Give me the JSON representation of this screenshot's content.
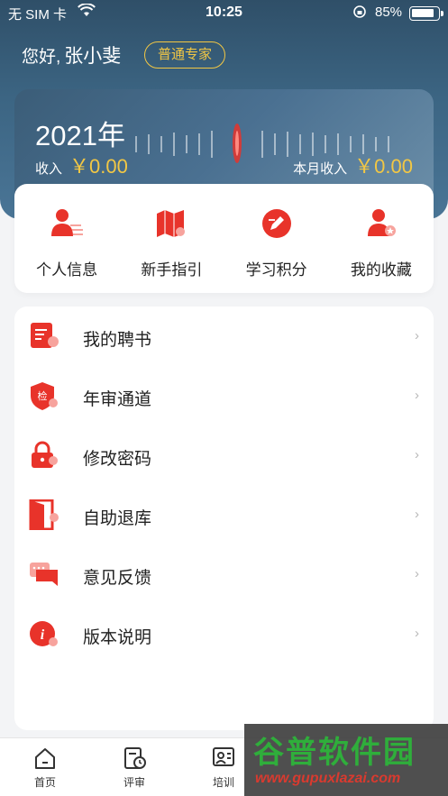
{
  "status_bar": {
    "carrier": "无 SIM 卡",
    "time": "10:25",
    "battery": "85%"
  },
  "header": {
    "greeting": "您好,",
    "name": "张小斐",
    "role": "普通专家"
  },
  "income": {
    "year": "2021年",
    "income_label": "收入",
    "income_value": "￥0.00",
    "month_label": "本月收入",
    "month_value": "￥0.00"
  },
  "quick_actions": [
    {
      "label": "个人信息",
      "icon": "person-card-icon"
    },
    {
      "label": "新手指引",
      "icon": "map-icon"
    },
    {
      "label": "学习积分",
      "icon": "pencil-circle-icon"
    },
    {
      "label": "我的收藏",
      "icon": "person-star-icon"
    }
  ],
  "menu": [
    {
      "label": "我的聘书",
      "icon": "certificate-icon"
    },
    {
      "label": "年审通道",
      "icon": "shield-check-icon",
      "badge": "检"
    },
    {
      "label": "修改密码",
      "icon": "lock-icon"
    },
    {
      "label": "自助退库",
      "icon": "door-icon"
    },
    {
      "label": "意见反馈",
      "icon": "chat-icon"
    },
    {
      "label": "版本说明",
      "icon": "info-icon",
      "badge": "i"
    }
  ],
  "chevron": "›",
  "tabs": [
    {
      "label": "首页",
      "icon": "home-icon"
    },
    {
      "label": "评审",
      "icon": "review-clock-icon"
    },
    {
      "label": "培训",
      "icon": "training-icon"
    }
  ],
  "watermark": {
    "title": "谷普软件园",
    "url": "www.gupuxlazai.com"
  },
  "colors": {
    "header": "#3c6583",
    "accent_gold": "#f2c744",
    "brand_red": "#e8332a",
    "bg": "#f3f4f6"
  }
}
